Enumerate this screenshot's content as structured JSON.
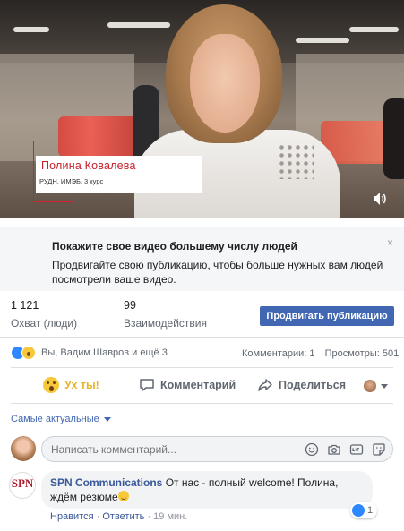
{
  "video": {
    "name": "Полина Ковалева",
    "subtitle": "РУДН, ИМЭБ, 3 курс",
    "volume_icon": "volume-icon"
  },
  "boost": {
    "title": "Покажите свое видео большему числу людей",
    "description": "Продвигайте свою публикацию, чтобы больше нужных вам людей посмотрели ваше видео.",
    "close_label": "×"
  },
  "stats": {
    "reach_value": "1 121",
    "reach_label": "Охват (люди)",
    "engagement_value": "99",
    "engagement_label": "Взаимодействия",
    "promote_label": "Продвигать публикацию"
  },
  "reactions": {
    "summary": "Вы, Вадим Шавров и ещё 3",
    "comments": "Комментарии: 1",
    "views": "Просмотры: 501"
  },
  "actions": {
    "wow": "Ух ты!",
    "comment": "Комментарий",
    "share": "Поделиться"
  },
  "comments_section": {
    "sort_label": "Самые актуальные",
    "input_placeholder": "Написать комментарий...",
    "comment": {
      "author": "SPN Communications",
      "text": "От нас - полный welcome! Полина, ждём резюме",
      "like_count": "1",
      "like_link": "Нравится",
      "reply_link": "Ответить",
      "time": "19 мин.",
      "separator": "·",
      "logo_text": "SPN"
    }
  },
  "colors": {
    "accent": "#4267b2",
    "link": "#385898",
    "wow": "#e9b428"
  }
}
